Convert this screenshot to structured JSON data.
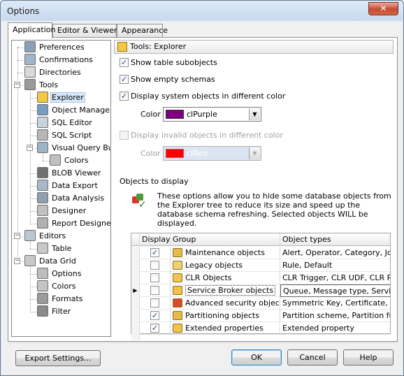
{
  "window": {
    "title": "Options",
    "close_label": "✕"
  },
  "tabs": [
    {
      "label": "Application"
    },
    {
      "label": "Editor & Viewers"
    },
    {
      "label": "Appearance"
    }
  ],
  "tree": [
    {
      "label": "Preferences",
      "icon": "preferences-icon"
    },
    {
      "label": "Confirmations",
      "icon": "confirmations-icon"
    },
    {
      "label": "Directories",
      "icon": "directories-icon"
    },
    {
      "label": "Tools",
      "icon": "tools-icon"
    },
    {
      "label": "Explorer",
      "icon": "explorer-icon"
    },
    {
      "label": "Object Manager",
      "icon": "object-manager-icon"
    },
    {
      "label": "SQL Editor",
      "icon": "sql-editor-icon"
    },
    {
      "label": "SQL Script",
      "icon": "sql-script-icon"
    },
    {
      "label": "Visual Query Build",
      "icon": "visual-query-builder-icon"
    },
    {
      "label": "Colors",
      "icon": "colors-icon"
    },
    {
      "label": "BLOB Viewer",
      "icon": "blob-viewer-icon"
    },
    {
      "label": "Data Export",
      "icon": "data-export-icon"
    },
    {
      "label": "Data Analysis",
      "icon": "data-analysis-icon"
    },
    {
      "label": "Designer",
      "icon": "designer-icon"
    },
    {
      "label": "Report Designer",
      "icon": "report-designer-icon"
    },
    {
      "label": "Editors",
      "icon": "editors-icon"
    },
    {
      "label": "Table",
      "icon": "table-icon"
    },
    {
      "label": "Data Grid",
      "icon": "data-grid-icon"
    },
    {
      "label": "Options",
      "icon": "grid-options-icon"
    },
    {
      "label": "Colors",
      "icon": "grid-colors-icon"
    },
    {
      "label": "Formats",
      "icon": "formats-icon"
    },
    {
      "label": "Filter",
      "icon": "filter-icon"
    }
  ],
  "panel": {
    "header": "Tools: Explorer",
    "show_table_subobjects": "Show table subobjects",
    "show_empty_schemas": "Show empty schemas",
    "display_system_objects": "Display system objects in different color",
    "color_label": "Color",
    "system_color": {
      "name": "clPurple",
      "hex": "#800080"
    },
    "display_invalid_objects": "Display invalid objects in different color",
    "invalid_color": {
      "name": "clRed",
      "hex": "#ff0000"
    },
    "objects_to_display_label": "Objects to display",
    "info_text": "These options allow you to hide some database objects from the Explorer tree to reduce its size and speed up the database schema refreshing. Selected objects WILL be displayed."
  },
  "grid": {
    "headers": {
      "display": "Display",
      "group": "Group",
      "types": "Object types"
    },
    "rows": [
      {
        "checked": true,
        "group": "Maintenance objects",
        "types": "Alert, Operator, Category, Job,",
        "icon_color": "#e8b94b"
      },
      {
        "checked": false,
        "group": "Legacy objects",
        "types": "Rule, Default",
        "icon_color": "#f0d070"
      },
      {
        "checked": false,
        "group": "CLR Objects",
        "types": "CLR Trigger, CLR UDF, CLR Proc",
        "icon_color": "#f0c850"
      },
      {
        "checked": false,
        "group": "Service Broker objects",
        "types": "Queue, Message type, Service,",
        "icon_color": "#f3c24a"
      },
      {
        "checked": false,
        "group": "Advanced security objects",
        "types": "Symmetric Key, Certificate, Asy",
        "icon_color": "#d84a2e"
      },
      {
        "checked": true,
        "group": "Partitioning objects",
        "types": "Partition scheme, Partition funct",
        "icon_color": "#e8b94b"
      },
      {
        "checked": true,
        "group": "Extended properties",
        "types": "Extended property",
        "icon_color": "#f3c24a"
      }
    ]
  },
  "buttons": {
    "export": "Export Settings...",
    "ok": "OK",
    "cancel": "Cancel",
    "help": "Help"
  },
  "check_glyph": "✓",
  "row_pointer": "▶"
}
